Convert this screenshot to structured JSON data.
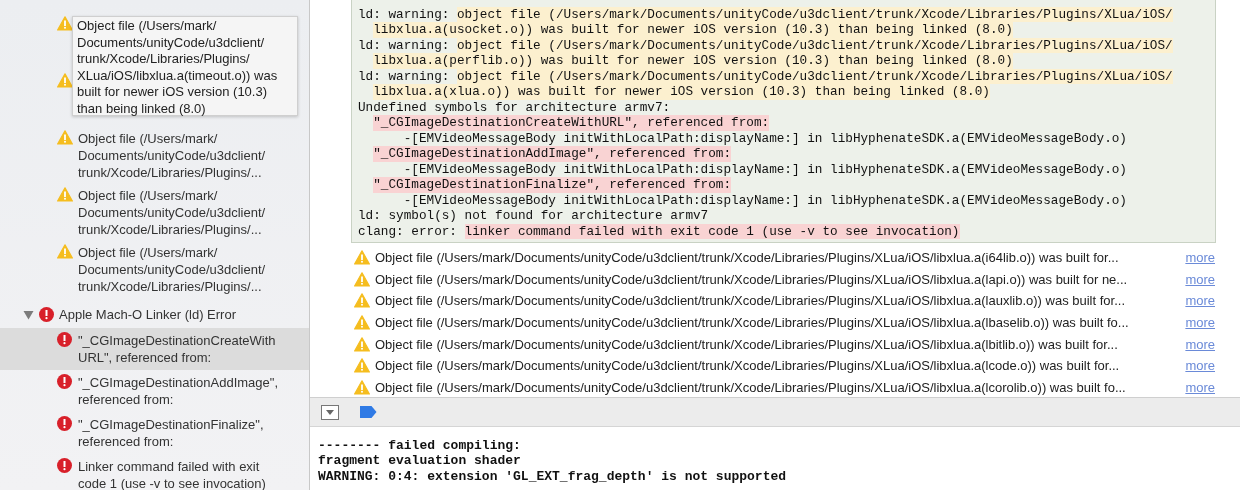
{
  "sidebar": {
    "items": [
      {
        "kind": "warning"
      },
      {
        "kind": "warning"
      },
      {
        "kind": "warning",
        "lines": [
          "Object file (/Users/mark/",
          "Documents/unityCode/u3dclient/",
          "trunk/Xcode/Libraries/Plugins/..."
        ]
      },
      {
        "kind": "warning",
        "lines": [
          "Object file (/Users/mark/",
          "Documents/unityCode/u3dclient/",
          "trunk/Xcode/Libraries/Plugins/..."
        ]
      },
      {
        "kind": "warning",
        "lines": [
          "Object file (/Users/mark/",
          "Documents/unityCode/u3dclient/",
          "trunk/Xcode/Libraries/Plugins/..."
        ]
      }
    ],
    "group": {
      "label": "Apple Mach-O Linker (ld) Error",
      "expanded": true,
      "children": [
        {
          "kind": "error",
          "selected": true,
          "lines": [
            "\"_CGImageDestinationCreateWith",
            "URL\", referenced from:"
          ]
        },
        {
          "kind": "error",
          "selected": false,
          "lines": [
            "\"_CGImageDestinationAddImage\",",
            "referenced from:"
          ]
        },
        {
          "kind": "error",
          "selected": false,
          "lines": [
            "\"_CGImageDestinationFinalize\",",
            "referenced from:"
          ]
        },
        {
          "kind": "error",
          "selected": false,
          "lines": [
            "Linker command failed with exit",
            "code 1 (use -v to see invocation)"
          ]
        }
      ]
    },
    "tooltip": {
      "lines": [
        "Object file (/Users/mark/",
        "Documents/unityCode/u3dclient/",
        "trunk/Xcode/Libraries/Plugins/",
        "XLua/iOS/libxlua.a(timeout.o)) was",
        "built for newer iOS version (10.3)",
        "than being linked (8.0)"
      ]
    }
  },
  "log": {
    "lines": [
      {
        "kind": "entry",
        "segments": [
          {
            "kind": "plain",
            "text": "ld: warning: "
          },
          {
            "kind": "warning",
            "text": "object file (/Users/mark/Documents/unityCode/u3dclient/trunk/Xcode/Libraries/Plugins/XLua/iOS/"
          }
        ]
      },
      {
        "kind": "wrap",
        "segments": [
          {
            "kind": "warning",
            "text": "libxlua.a(usocket.o)) was built for newer iOS version (10.3) than being linked (8.0)"
          }
        ]
      },
      {
        "kind": "entry",
        "segments": [
          {
            "kind": "plain",
            "text": "ld: warning: "
          },
          {
            "kind": "warning",
            "text": "object file (/Users/mark/Documents/unityCode/u3dclient/trunk/Xcode/Libraries/Plugins/XLua/iOS/"
          }
        ]
      },
      {
        "kind": "wrap",
        "segments": [
          {
            "kind": "warning",
            "text": "libxlua.a(perflib.o)) was built for newer iOS version (10.3) than being linked (8.0)"
          }
        ]
      },
      {
        "kind": "entry",
        "segments": [
          {
            "kind": "plain",
            "text": "ld: warning: "
          },
          {
            "kind": "warning",
            "text": "object file (/Users/mark/Documents/unityCode/u3dclient/trunk/Xcode/Libraries/Plugins/XLua/iOS/"
          }
        ]
      },
      {
        "kind": "wrap",
        "segments": [
          {
            "kind": "warning",
            "text": "libxlua.a(xlua.o)) was built for newer iOS version (10.3) than being linked (8.0)"
          }
        ]
      },
      {
        "kind": "entry",
        "segments": [
          {
            "kind": "plain",
            "text": "Undefined symbols for architecture armv7:"
          }
        ]
      },
      {
        "kind": "symbol",
        "segments": [
          {
            "kind": "error",
            "text": "\"_CGImageDestinationCreateWithURL\", referenced from:"
          }
        ]
      },
      {
        "kind": "caller",
        "segments": [
          {
            "kind": "plain",
            "text": "-[EMVideoMessageBody initWithLocalPath:displayName:] in libHyphenateSDK.a(EMVideoMessageBody.o)"
          }
        ]
      },
      {
        "kind": "symbol",
        "segments": [
          {
            "kind": "error",
            "text": "\"_CGImageDestinationAddImage\", referenced from:"
          }
        ]
      },
      {
        "kind": "caller",
        "segments": [
          {
            "kind": "plain",
            "text": "-[EMVideoMessageBody initWithLocalPath:displayName:] in libHyphenateSDK.a(EMVideoMessageBody.o)"
          }
        ]
      },
      {
        "kind": "symbol",
        "segments": [
          {
            "kind": "error",
            "text": "\"_CGImageDestinationFinalize\", referenced from:"
          }
        ]
      },
      {
        "kind": "caller",
        "segments": [
          {
            "kind": "plain",
            "text": "-[EMVideoMessageBody initWithLocalPath:displayName:] in libHyphenateSDK.a(EMVideoMessageBody.o)"
          }
        ]
      },
      {
        "kind": "entry",
        "segments": [
          {
            "kind": "plain",
            "text": "ld: symbol(s) not found for architecture armv7"
          }
        ]
      },
      {
        "kind": "entry",
        "segments": [
          {
            "kind": "plain",
            "text": "clang: error: "
          },
          {
            "kind": "error",
            "text": "linker command failed with exit code 1 (use -v to see invocation)"
          }
        ]
      }
    ]
  },
  "issues": [
    {
      "kind": "warning",
      "text": "Object file (/Users/mark/Documents/unityCode/u3dclient/trunk/Xcode/Libraries/Plugins/XLua/iOS/libxlua.a(i64lib.o)) was built for...",
      "link": "more"
    },
    {
      "kind": "warning",
      "text": "Object file (/Users/mark/Documents/unityCode/u3dclient/trunk/Xcode/Libraries/Plugins/XLua/iOS/libxlua.a(lapi.o)) was built for ne...",
      "link": "more"
    },
    {
      "kind": "warning",
      "text": "Object file (/Users/mark/Documents/unityCode/u3dclient/trunk/Xcode/Libraries/Plugins/XLua/iOS/libxlua.a(lauxlib.o)) was built for...",
      "link": "more"
    },
    {
      "kind": "warning",
      "text": "Object file (/Users/mark/Documents/unityCode/u3dclient/trunk/Xcode/Libraries/Plugins/XLua/iOS/libxlua.a(lbaselib.o)) was built fo...",
      "link": "more"
    },
    {
      "kind": "warning",
      "text": "Object file (/Users/mark/Documents/unityCode/u3dclient/trunk/Xcode/Libraries/Plugins/XLua/iOS/libxlua.a(lbitlib.o)) was built for...",
      "link": "more"
    },
    {
      "kind": "warning",
      "text": "Object file (/Users/mark/Documents/unityCode/u3dclient/trunk/Xcode/Libraries/Plugins/XLua/iOS/libxlua.a(lcode.o)) was built for...",
      "link": "more"
    },
    {
      "kind": "warning",
      "text": "Object file (/Users/mark/Documents/unityCode/u3dclient/trunk/Xcode/Libraries/Plugins/XLua/iOS/libxlua.a(lcorolib.o)) was built fo...",
      "link": "more"
    }
  ],
  "console": {
    "lines": [
      "-------- failed compiling:",
      "fragment evaluation shader",
      "WARNING: 0:4: extension 'GL_EXT_frag_depth' is not supported"
    ]
  }
}
